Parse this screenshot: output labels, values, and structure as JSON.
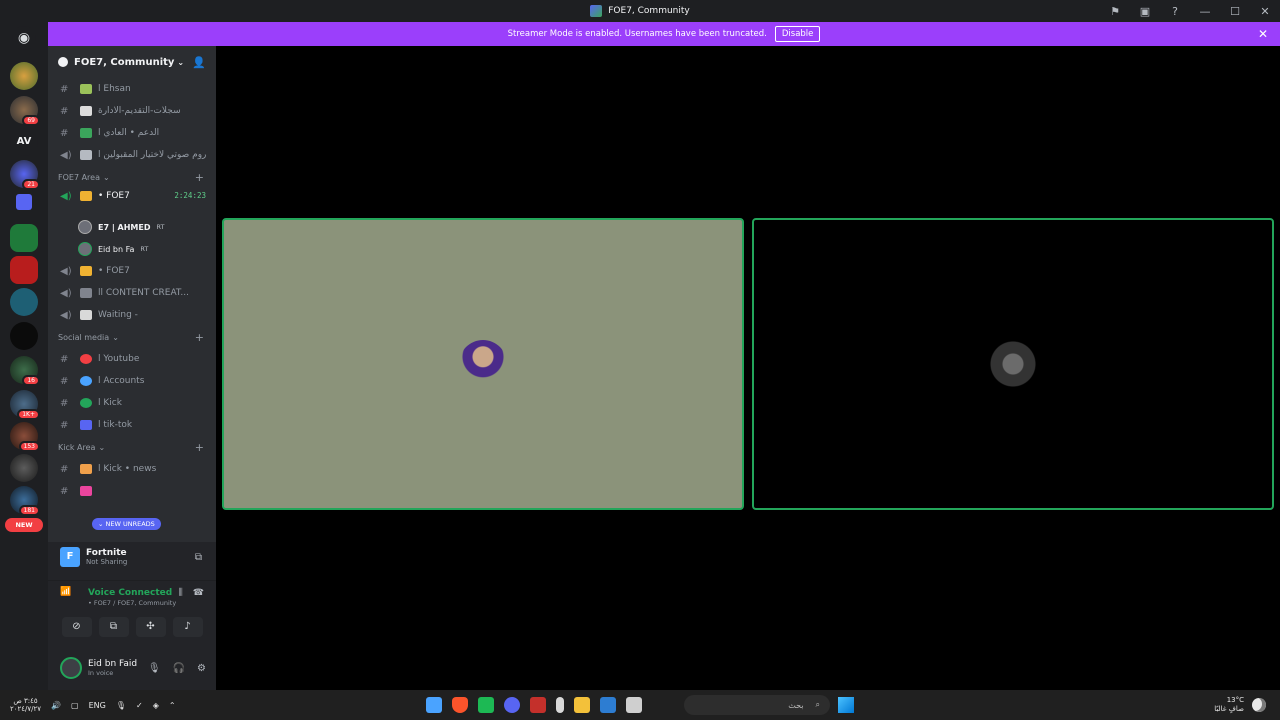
{
  "window": {
    "title": "FOE7, Community"
  },
  "banner": {
    "message": "Streamer Mode is enabled. Usernames have been truncated.",
    "disable_label": "Disable"
  },
  "rail": {
    "av_label": "AV",
    "badges": [
      "69",
      "21",
      "16",
      "1K+",
      "153",
      "181"
    ],
    "new_label": "NEW"
  },
  "server": {
    "name": "FOE7, Community"
  },
  "channels_top": [
    {
      "type": "text",
      "label": "ا Ehsan"
    },
    {
      "type": "text",
      "label": "سجلات-التقديم-الادارة"
    },
    {
      "type": "text",
      "label": "الدعم • العادي ا"
    },
    {
      "type": "voice",
      "label": "روم صوتي لاختيار المقبولين ا"
    }
  ],
  "categories": {
    "foe7_area": "FOE7 Area",
    "social_media": "Social media",
    "kick_area": "Kick Area"
  },
  "voice_active": {
    "name": "• FOE7",
    "timer": "2:24:23",
    "users": [
      {
        "name": "E7 | AHMED",
        "tag": "RT"
      },
      {
        "name": "Eid bn Fa",
        "tag": "RT"
      }
    ]
  },
  "channels_foe7": [
    {
      "type": "voice",
      "label": "• FOE7"
    },
    {
      "type": "voice",
      "label": "اا CONTENT CREAT..."
    },
    {
      "type": "voice",
      "label": "Waiting -"
    }
  ],
  "channels_social": [
    {
      "label": "ا Youtube",
      "color": "#f23f43"
    },
    {
      "label": "ا Accounts",
      "color": "#4aa3ff"
    },
    {
      "label": "ا Kick",
      "color": "#23a55a"
    },
    {
      "label": "ا tik-tok",
      "color": "#5865f2"
    }
  ],
  "channels_kick": [
    {
      "label": "ا Kick • news",
      "color": "#f0a04b"
    }
  ],
  "new_unreads": "NEW UNREADS",
  "activity": {
    "icon_letter": "F",
    "title": "Fortnite",
    "subtitle": "Not Sharing"
  },
  "voice_status": {
    "label": "Voice Connected",
    "location": "• FOE7 / FOE7, Community"
  },
  "user": {
    "name": "Eid bn Faid",
    "status": "In voice"
  },
  "taskbar": {
    "date_line1": "٣:٤٥ ص",
    "date_line2": "٢٠٢٤/٧/٢٧",
    "lang": "ENG",
    "search_placeholder": "بحث",
    "weather_temp": "13°C",
    "weather_text": "صافٍ غالبًا"
  }
}
